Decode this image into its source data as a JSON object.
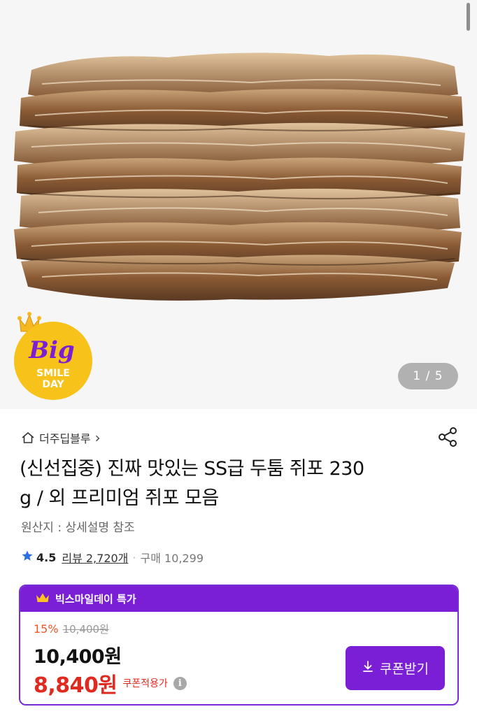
{
  "hero": {
    "pager": "1 / 5",
    "badge": {
      "line1": "Big",
      "line2": "SMILE",
      "line3": "DAY"
    }
  },
  "store": {
    "name": "더주딥블루",
    "chevron": "›"
  },
  "product": {
    "title_line1": "(신선집중) 진짜 맛있는 SS급 두툼 쥐포 230",
    "title_line2": "g / 외 프리미엄 쥐포 모음",
    "origin": "원산지 : 상세설명 참조"
  },
  "rating": {
    "score": "4.5",
    "review": "리뷰 2,720개",
    "separator": "·",
    "purchases": "구매 10,299"
  },
  "deal": {
    "header": "빅스마일데이 특가",
    "discount_rate": "15%",
    "original_price": "10,400원",
    "price": "10,400원",
    "coupon_price": "8,840원",
    "coupon_label": "쿠폰적용가",
    "info_glyph": "i",
    "coupon_button": "쿠폰받기"
  },
  "colors": {
    "accent": "#7a1fd6",
    "sale": "#e02a20",
    "discount": "#f0552a",
    "star": "#2f6fe0"
  },
  "icons": [
    "home-icon",
    "share-icon",
    "star-icon",
    "crown-icon",
    "download-icon",
    "info-icon"
  ]
}
